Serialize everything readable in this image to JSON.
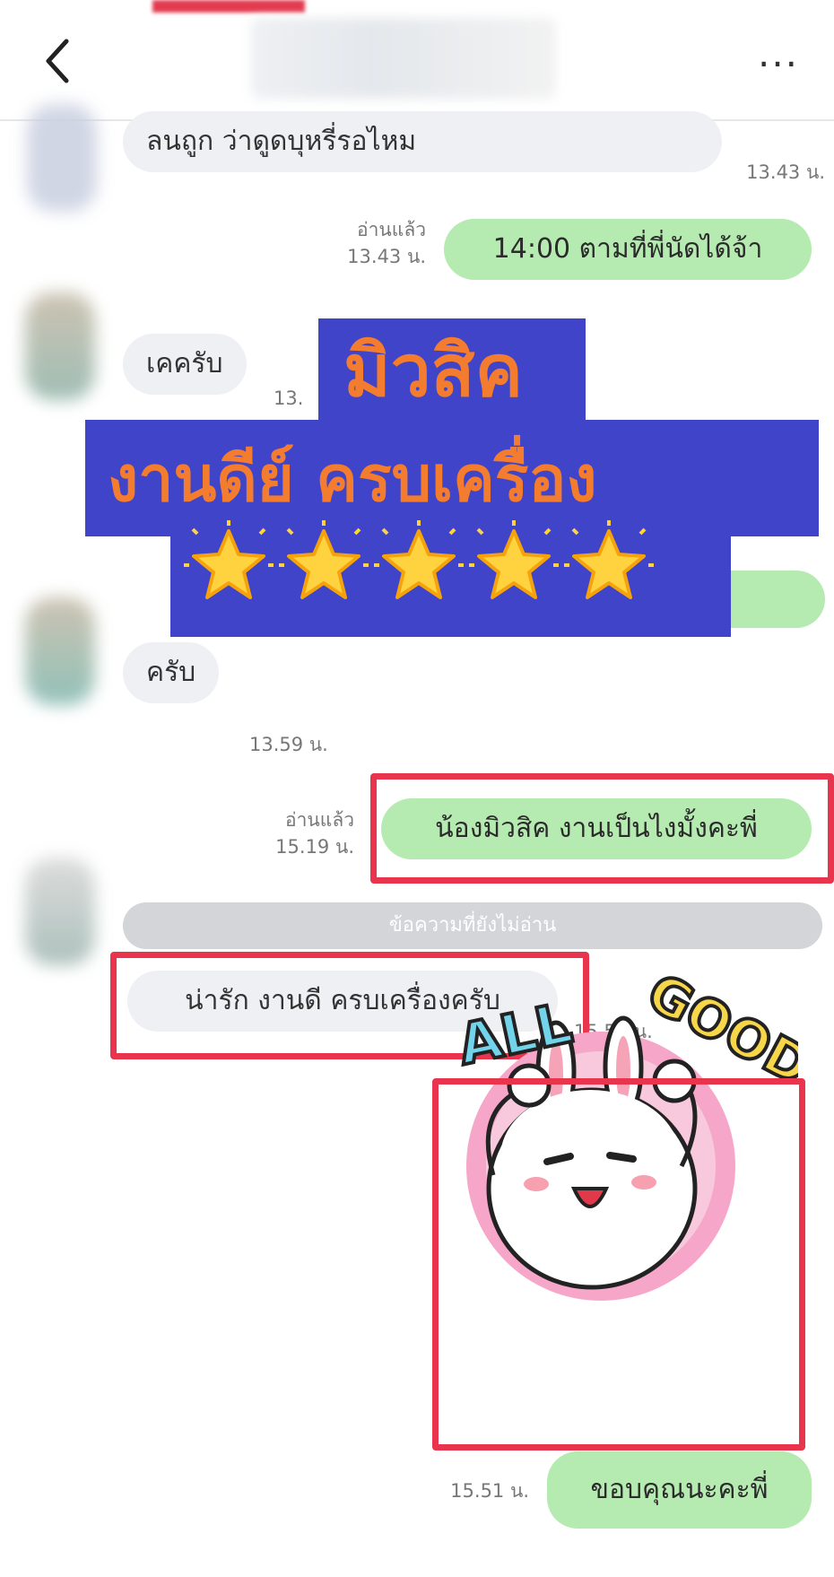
{
  "header": {
    "back_label": "<",
    "more_label": "..."
  },
  "messages": [
    {
      "id": "m1",
      "side": "in",
      "text": "ลนถูก ว่าดูดบุหรี่รอไหม",
      "time": "13.43 น."
    },
    {
      "id": "m2",
      "side": "out",
      "text": "14:00 ตามที่พี่นัดได้จ้า",
      "read": "อ่านแล้ว",
      "time": "13.43 น."
    },
    {
      "id": "m3",
      "side": "in",
      "text": "เคครับ",
      "time": "13."
    },
    {
      "id": "m4",
      "side": "in",
      "text": "ครับ",
      "time": "13.59 น."
    },
    {
      "id": "m5",
      "side": "out",
      "text": "น้องมิวสิค งานเป็นไงมั้งคะพี่",
      "read": "อ่านแล้ว",
      "time": "15.19 น."
    },
    {
      "id": "m6",
      "side": "in",
      "text": "น่ารัก งานดี ครบเครื่องครับ",
      "time": "15.51 น."
    },
    {
      "id": "m7",
      "side": "out",
      "sticker": "all-good-rabbit"
    },
    {
      "id": "m8",
      "side": "out",
      "text": "ขอบคุณนะคะพี่",
      "time": "15.51 น."
    }
  ],
  "unread_divider": "ข้อความที่ยังไม่อ่าน",
  "overlay": {
    "line1": "มิวสิค",
    "line2": "งานดีย์ ครบเครื่อง",
    "rating": 5,
    "rating_max": 5
  },
  "sticker": {
    "word1": "ALL",
    "word2": "GOOD!"
  },
  "colors": {
    "incoming_bubble": "#eef0f3",
    "outgoing_bubble": "#b5ebb0",
    "highlight": "#e8344d",
    "overlay_bg": "#3f44c8",
    "overlay_text": "#f47c2e"
  }
}
